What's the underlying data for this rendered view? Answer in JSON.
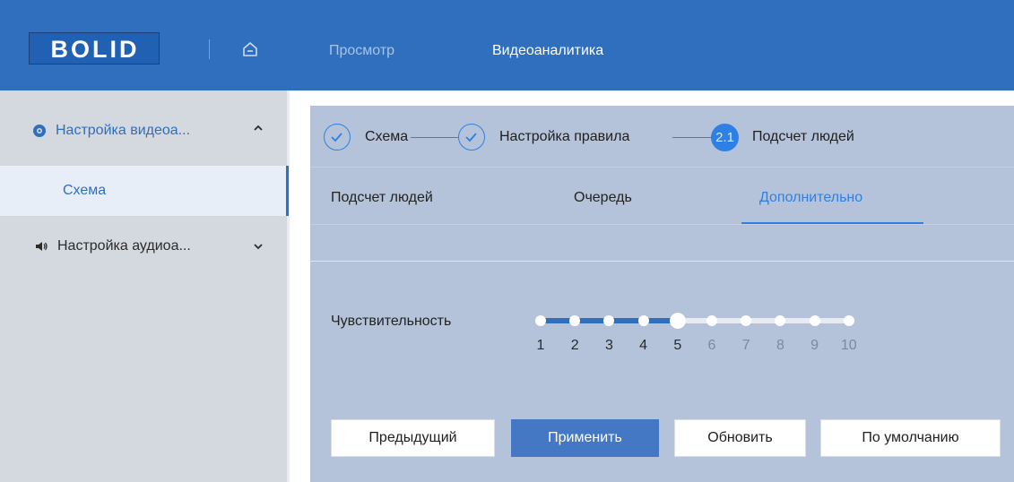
{
  "header": {
    "logo_text": "BOLID",
    "nav": [
      {
        "label": "Просмотр"
      },
      {
        "label": "Видеоаналитика"
      }
    ]
  },
  "sidebar": {
    "items": [
      {
        "label": "Настройка видеоа...",
        "icon": "video-analytics-icon",
        "expanded": true
      },
      {
        "label": "Схема",
        "selected": true
      },
      {
        "label": "Настройка аудиоа...",
        "icon": "speaker-icon",
        "expanded": false
      }
    ]
  },
  "steps": [
    {
      "label": "Схема",
      "state": "done"
    },
    {
      "label": "Настройка правила",
      "state": "done"
    },
    {
      "number": "2.1",
      "label": "Подсчет людей",
      "state": "active"
    }
  ],
  "tabs": [
    {
      "label": "Подсчет людей"
    },
    {
      "label": "Очередь"
    },
    {
      "label": "Дополнительно",
      "active": true
    }
  ],
  "sensitivity": {
    "label": "Чувствительность",
    "value": 5,
    "min": 1,
    "max": 10,
    "ticks": [
      "1",
      "2",
      "3",
      "4",
      "5",
      "6",
      "7",
      "8",
      "9",
      "10"
    ]
  },
  "buttons": {
    "prev": "Предыдущий",
    "apply": "Применить",
    "refresh": "Обновить",
    "default": "По умолчанию"
  },
  "colors": {
    "accent": "#2f6fbd",
    "active_step": "#2f80e4",
    "panel_bg": "#b4c3d9"
  }
}
